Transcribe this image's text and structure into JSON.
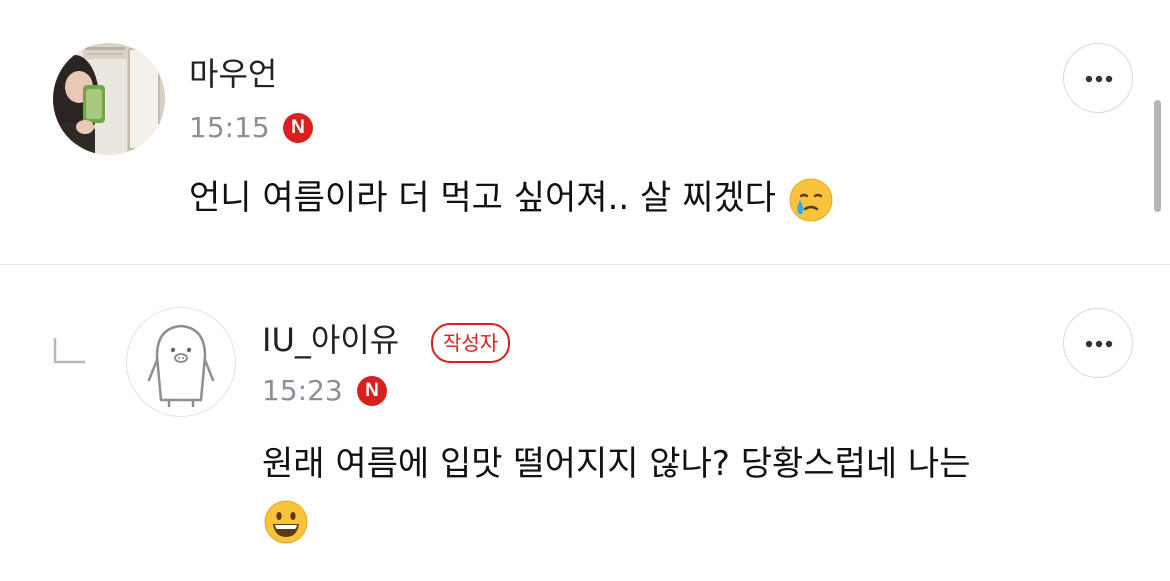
{
  "comments": [
    {
      "author": "마우언",
      "time": "15:15",
      "network_badge": "N",
      "text": "언니 여름이라 더 먹고 싶어져.. 살 찌겠다",
      "emoji": "crying-face",
      "avatar": "user-photo-avatar",
      "more_icon": "more-horizontal-icon"
    },
    {
      "author": "IU_아이유",
      "author_badge": "작성자",
      "time": "15:23",
      "network_badge": "N",
      "text": "원래 여름에 입맛 떨어지지 않나? 당황스럽네 나는",
      "emoji": "grinning-face",
      "avatar": "penguin-mascot-avatar",
      "reply_icon": "reply-arrow-icon",
      "more_icon": "more-horizontal-icon"
    }
  ],
  "colors": {
    "accent_red": "#d9201e",
    "meta_gray": "#8a8f99",
    "divider": "#e4e4e4"
  }
}
